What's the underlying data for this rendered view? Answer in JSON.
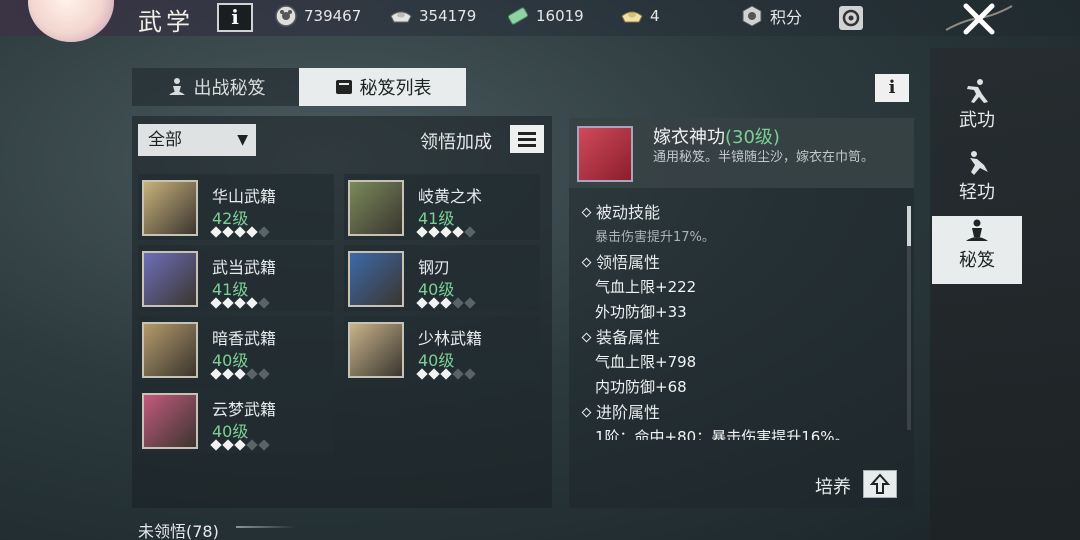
{
  "header": {
    "title": "武学",
    "info_label": "i",
    "resources": [
      {
        "icon": "coin-icon",
        "value": "739467"
      },
      {
        "icon": "silver-ingot-icon",
        "value": "354179"
      },
      {
        "icon": "jade-ticket-icon",
        "value": "16019"
      },
      {
        "icon": "gold-ingot-icon",
        "value": "4"
      }
    ],
    "points_label": "积分",
    "close_icon": "close-icon"
  },
  "tabs": [
    {
      "label": "出战秘笈",
      "icon": "meditate-icon",
      "active": false
    },
    {
      "label": "秘笈列表",
      "icon": "scroll-icon",
      "active": true
    }
  ],
  "info_button": "i",
  "filter": {
    "selected": "全部"
  },
  "boost_label": "领悟加成",
  "books": [
    {
      "name": "华山武籍",
      "level": "42级",
      "stars": 4,
      "max_stars": 5,
      "color": "#c8b27a"
    },
    {
      "name": "岐黄之术",
      "level": "41级",
      "stars": 4,
      "max_stars": 5,
      "color": "#7a8a5a"
    },
    {
      "name": "武当武籍",
      "level": "41级",
      "stars": 4,
      "max_stars": 5,
      "color": "#6d6fb8"
    },
    {
      "name": "钢刃",
      "level": "40级",
      "stars": 3,
      "max_stars": 5,
      "color": "#3d6aa8"
    },
    {
      "name": "暗香武籍",
      "level": "40级",
      "stars": 3,
      "max_stars": 5,
      "color": "#b39a6a"
    },
    {
      "name": "少林武籍",
      "level": "40级",
      "stars": 3,
      "max_stars": 5,
      "color": "#c9b48a"
    },
    {
      "name": "云梦武籍",
      "level": "40级",
      "stars": 3,
      "max_stars": 5,
      "color": "#c45a7e"
    }
  ],
  "unlearned": "未领悟(78)",
  "detail": {
    "name": "嫁衣神功",
    "level": "(30级)",
    "description": "通用秘笈。半镜随尘沙，嫁衣在巾笥。",
    "sections": [
      {
        "title": "被动技能",
        "lines": [
          {
            "text": "暴击伤害提升17%。",
            "style": "sub"
          }
        ]
      },
      {
        "title": "领悟属性",
        "lines": [
          {
            "text": "气血上限+222",
            "style": "val"
          },
          {
            "text": "外功防御+33",
            "style": "val"
          }
        ]
      },
      {
        "title": "装备属性",
        "lines": [
          {
            "text": "气血上限+798",
            "style": "val"
          },
          {
            "text": "内功防御+68",
            "style": "val"
          }
        ]
      },
      {
        "title": "进阶属性",
        "lines": [
          {
            "text": "1阶：命中+80；暴击伤害提升16%。",
            "style": "val"
          }
        ]
      }
    ],
    "train_label": "培养"
  },
  "sidenav": [
    {
      "label": "武功",
      "icon": "martial-stance-icon",
      "active": false
    },
    {
      "label": "轻功",
      "icon": "flying-kick-icon",
      "active": false
    },
    {
      "label": "秘笈",
      "icon": "meditate-icon",
      "active": true
    }
  ]
}
